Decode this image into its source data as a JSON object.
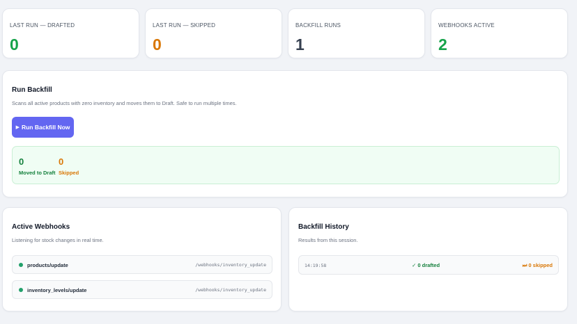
{
  "colors": {
    "green": "#16a34a",
    "orange": "#d97706",
    "dark": "#374151",
    "accent": "#6366f1"
  },
  "stats": [
    {
      "label": "LAST RUN — DRAFTED",
      "value": "0"
    },
    {
      "label": "LAST RUN — SKIPPED",
      "value": "0"
    },
    {
      "label": "BACKFILL RUNS",
      "value": "1"
    },
    {
      "label": "WEBHOOKS ACTIVE",
      "value": "2"
    }
  ],
  "backfill": {
    "title": "Run Backfill",
    "description": "Scans all active products with zero inventory and moves them to Draft. Safe to run multiple times.",
    "button_label": "Run Backfill Now",
    "button_icon": "play-icon",
    "result": {
      "moved_value": "0",
      "moved_label": "Moved to Draft",
      "skipped_value": "0",
      "skipped_label": "Skipped"
    }
  },
  "webhooks": {
    "title": "Active Webhooks",
    "description": "Listening for stock changes in real time.",
    "items": [
      {
        "topic": "products/update",
        "path": "/webhooks/inventory_update"
      },
      {
        "topic": "inventory_levels/update",
        "path": "/webhooks/inventory_update"
      }
    ]
  },
  "history": {
    "title": "Backfill History",
    "description": "Results from this session.",
    "entries": [
      {
        "time": "14:19:58",
        "drafted": "✓ 0 drafted",
        "skipped": "⏭ 0 skipped"
      }
    ]
  }
}
